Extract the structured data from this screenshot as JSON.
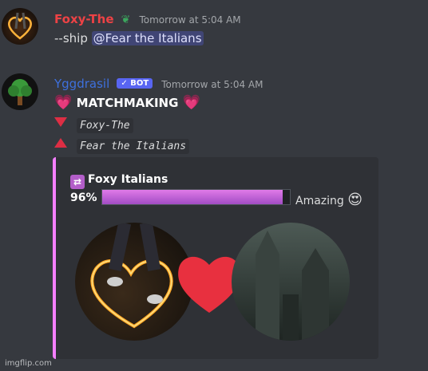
{
  "message1": {
    "author": "Foxy-The",
    "author_color": "#ed4245",
    "badge_icon": "sprout-icon",
    "timestamp": "Tomorrow at 5:04 AM",
    "command": "--ship ",
    "mention": "@Fear the Italians"
  },
  "message2": {
    "author": "Yggdrasil",
    "author_color": "#3e70dd",
    "bot_tag": "✓ BOT",
    "timestamp": "Tomorrow at 5:04 AM",
    "heading": "MATCHMAKING",
    "down_user": "Foxy-The",
    "up_user": "Fear the Italians"
  },
  "embed": {
    "accent_color": "#f47fff",
    "title": "Foxy Italians",
    "percent_label": "96%",
    "percent_value": 0.96,
    "verdict": "Amazing"
  },
  "watermark": "imgflip.com"
}
